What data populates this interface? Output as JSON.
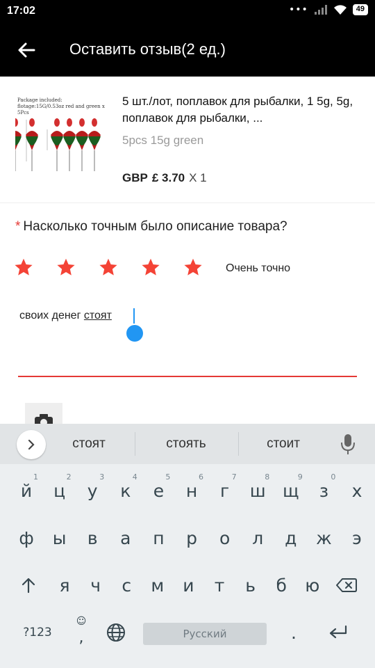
{
  "status": {
    "time": "17:02",
    "battery": "49"
  },
  "header": {
    "title": "Оставить отзыв(2 ед.)"
  },
  "product": {
    "thumb_text_line1": "Package included:",
    "thumb_text_line2": "flotage:15G/0.53oz  red and green  x 5Pcs",
    "name": "5 шт./лот, поплавок для рыбалки, 1 5g, 5g, поплавок для рыбалки, ...",
    "variant": "5pcs 15g green",
    "currency": "GBP",
    "price": "£ 3.70",
    "qty": "X 1"
  },
  "question": {
    "asterisk": "*",
    "text": "Насколько точным было описание товара?"
  },
  "rating": {
    "stars": 5,
    "label": "Очень точно",
    "color": "#f44336"
  },
  "review_input": {
    "text_before": "своих денег ",
    "text_suggest": "стоят",
    "underline_color": "#e53935"
  },
  "keyboard": {
    "suggestions": [
      "стоят",
      "стоять",
      "стоит"
    ],
    "row1": [
      {
        "k": "й",
        "h": "1"
      },
      {
        "k": "ц",
        "h": "2"
      },
      {
        "k": "у",
        "h": "3"
      },
      {
        "k": "к",
        "h": "4"
      },
      {
        "k": "е",
        "h": "5"
      },
      {
        "k": "н",
        "h": "6"
      },
      {
        "k": "г",
        "h": "7"
      },
      {
        "k": "ш",
        "h": "8"
      },
      {
        "k": "щ",
        "h": "9"
      },
      {
        "k": "з",
        "h": "0"
      },
      {
        "k": "х",
        "h": ""
      }
    ],
    "row2": [
      "ф",
      "ы",
      "в",
      "а",
      "п",
      "р",
      "о",
      "л",
      "д",
      "ж",
      "э"
    ],
    "row3": [
      "я",
      "ч",
      "с",
      "м",
      "и",
      "т",
      "ь",
      "б",
      "ю"
    ],
    "sym_label": "?123",
    "comma": ",",
    "space_label": "Русский",
    "period": "."
  }
}
